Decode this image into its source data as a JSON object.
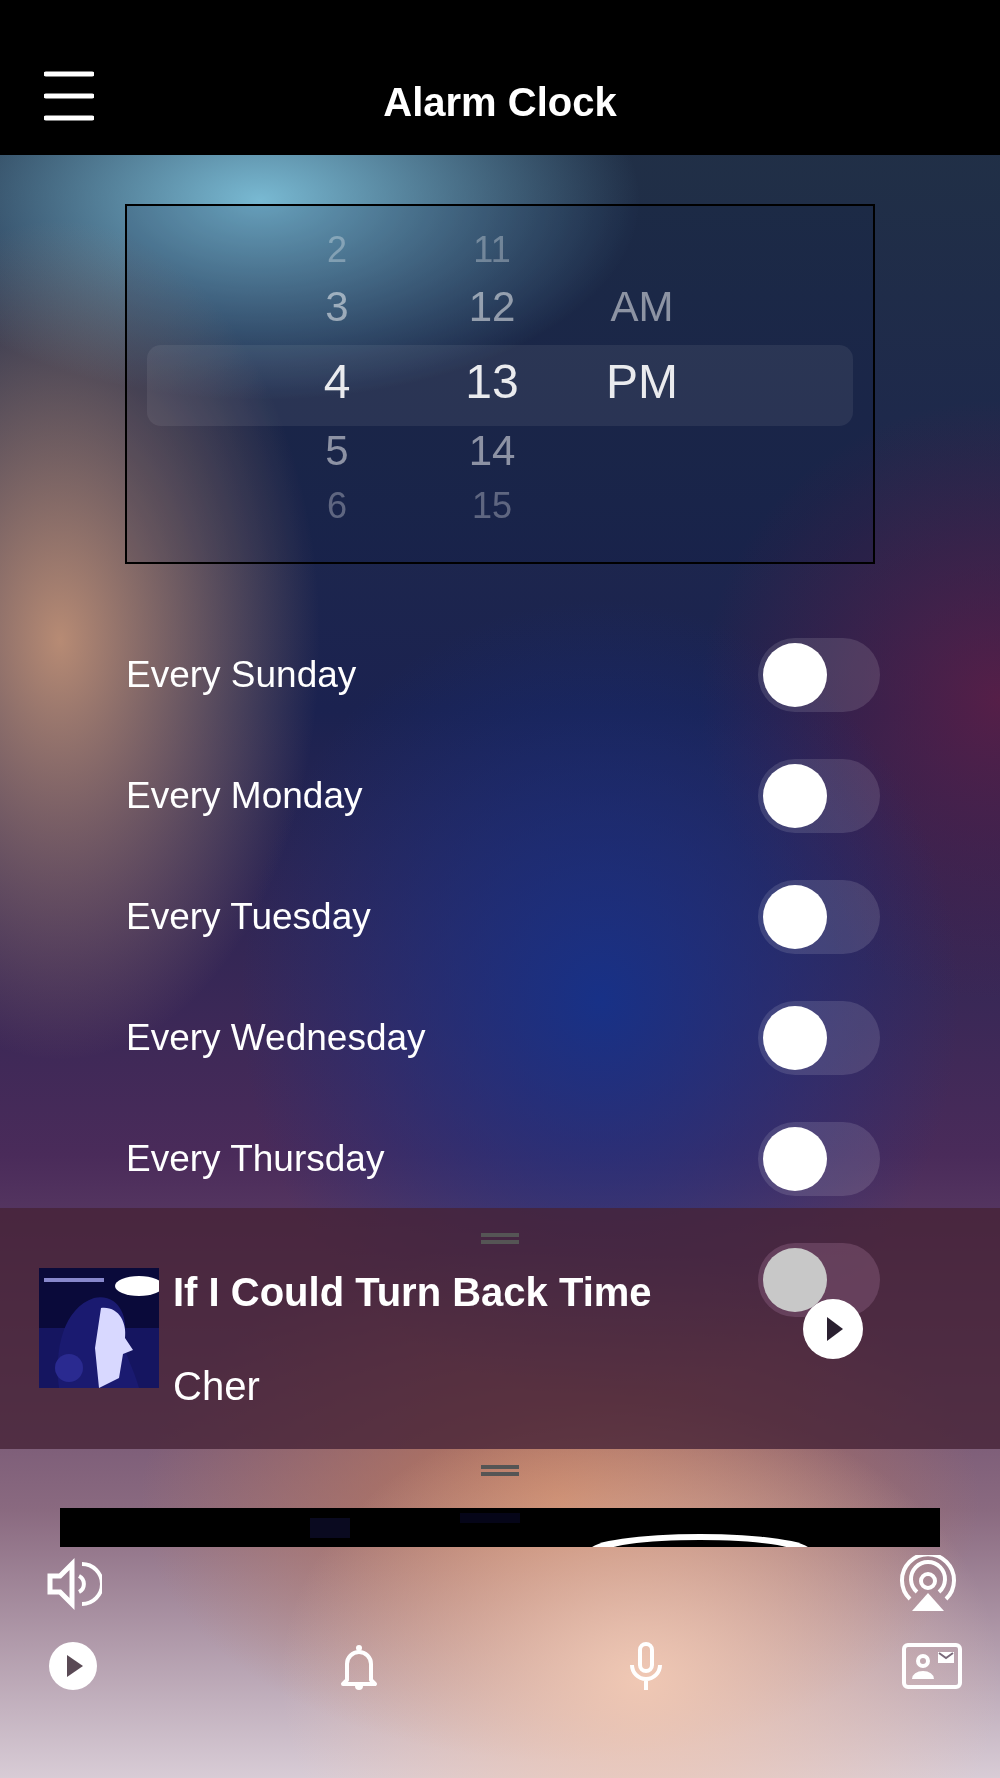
{
  "header": {
    "title": "Alarm Clock"
  },
  "time_picker": {
    "columns": [
      {
        "kind": "hour",
        "items": [
          {
            "label": "2",
            "selected": false
          },
          {
            "label": "3",
            "selected": false
          },
          {
            "label": "4",
            "selected": true
          },
          {
            "label": "5",
            "selected": false
          },
          {
            "label": "6",
            "selected": false
          }
        ]
      },
      {
        "kind": "minute",
        "items": [
          {
            "label": "11",
            "selected": false
          },
          {
            "label": "12",
            "selected": false
          },
          {
            "label": "13",
            "selected": true
          },
          {
            "label": "14",
            "selected": false
          },
          {
            "label": "15",
            "selected": false
          }
        ]
      },
      {
        "kind": "period",
        "items": [
          {
            "label": "AM",
            "selected": false
          },
          {
            "label": "PM",
            "selected": true
          }
        ]
      }
    ]
  },
  "repeat_days": [
    {
      "label": "Every Sunday",
      "on": false
    },
    {
      "label": "Every Monday",
      "on": false
    },
    {
      "label": "Every Tuesday",
      "on": false
    },
    {
      "label": "Every Wednesday",
      "on": false
    },
    {
      "label": "Every Thursday",
      "on": false
    },
    {
      "on": false
    }
  ],
  "now_playing": {
    "title": "If I Could Turn Back Time",
    "artist": "Cher"
  }
}
